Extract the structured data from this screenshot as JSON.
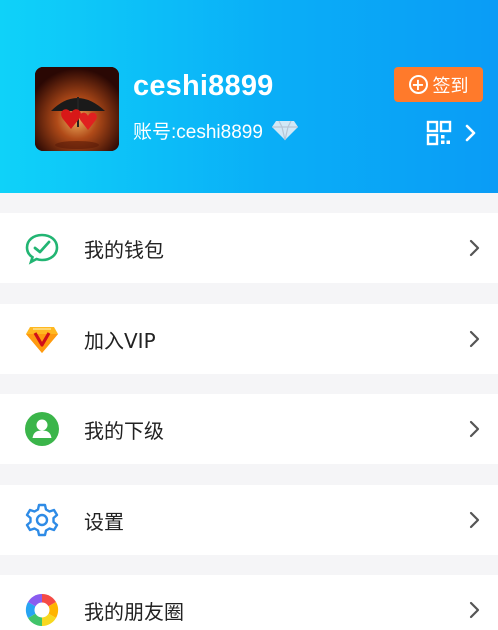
{
  "profile": {
    "username": "ceshi8899",
    "account_label": "账号:ceshi8899",
    "avatar_icon": "avatar-hearts-umbrella",
    "diamond_icon": "diamond-icon",
    "checkin_label": "签到",
    "qr_icon": "qr-code-icon"
  },
  "colors": {
    "header_gradient_start": "#0fd2f9",
    "header_gradient_end": "#0a9cf6",
    "checkin_bg": "#ff7a2b"
  },
  "menu": {
    "items": [
      {
        "label": "我的钱包",
        "icon": "wallet-icon"
      },
      {
        "label": "加入VIP",
        "icon": "vip-icon"
      },
      {
        "label": "我的下级",
        "icon": "user-icon"
      },
      {
        "label": "设置",
        "icon": "gear-icon"
      },
      {
        "label": "我的朋友圈",
        "icon": "moments-icon"
      }
    ]
  }
}
